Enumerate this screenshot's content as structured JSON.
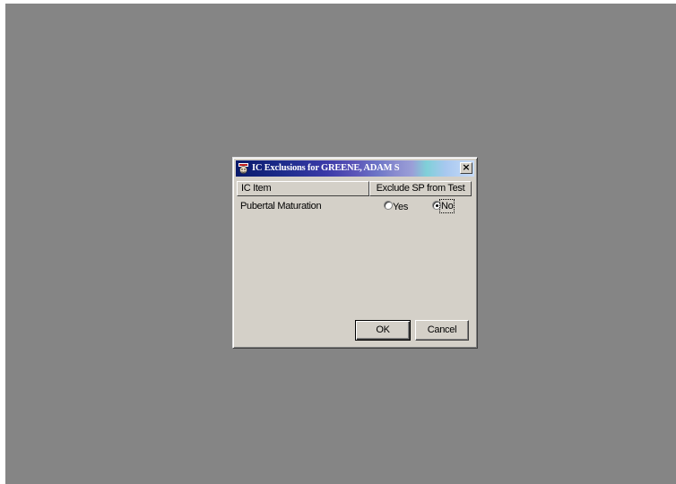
{
  "dialog": {
    "title": "IC Exclusions for GREENE, ADAM S",
    "title_icon": "app-icon",
    "close_glyph": "×",
    "columns": {
      "item": "IC Item",
      "exclude": "Exclude SP from Test"
    },
    "rows": [
      {
        "item": "Pubertal Maturation",
        "options": [
          {
            "label": "Yes",
            "selected": false
          },
          {
            "label": "No",
            "selected": true
          }
        ]
      }
    ],
    "buttons": {
      "ok": "OK",
      "cancel": "Cancel"
    }
  },
  "colors": {
    "desktop": "#858585",
    "dialog_face": "#d4d0c8",
    "title_start": "#0a1a6a",
    "title_end": "#c8dcf8"
  }
}
